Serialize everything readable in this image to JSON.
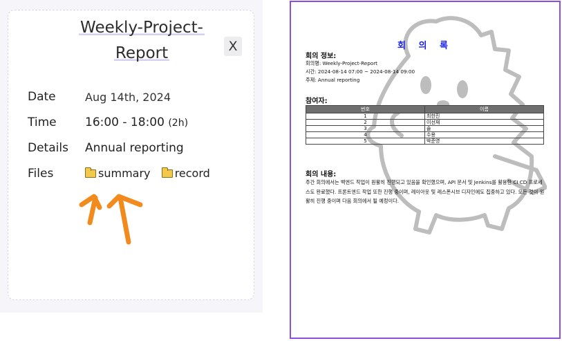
{
  "card": {
    "title_line1": "Weekly-Project-",
    "title_line2": "Report",
    "close_label": "X",
    "date_label": "Date",
    "date_value": "Aug 14th, 2024",
    "time_label": "Time",
    "time_value": "16:00 - 18:00",
    "time_duration": "(2h)",
    "details_label": "Details",
    "details_value": "Annual reporting",
    "files_label": "Files",
    "files": [
      "summary",
      "record"
    ]
  },
  "doc": {
    "title": "회 의 록",
    "info_heading": "회의 정보:",
    "meeting_name": "회의명: Weekly-Project-Report",
    "meeting_time": "시간: 2024-08-14 07:00 ~ 2024-08-14 09:00",
    "meeting_topic": "주제: Annual reporting",
    "participants_heading": "참여자:",
    "table_headers": [
      "번호",
      "이름"
    ],
    "participants": [
      {
        "num": "1",
        "name": "최한진"
      },
      {
        "num": "2",
        "name": "이선재"
      },
      {
        "num": "3",
        "name": "솔"
      },
      {
        "num": "4",
        "name": "수용"
      },
      {
        "num": "5",
        "name": "박준영"
      }
    ],
    "content_heading": "회의 내용:",
    "content": "주간 회의에서는 백엔드 작업이 원활히 진행되고 있음을 확인했으며, API 문서 및 Jenkins를 활용한 CI CD 프로세스도 완료했다. 프론트엔드 작업 또한 진행 중이며, 레이아웃 및 레스폰시브 디자인에도 집중하고 있다. 모든 것이 원활히 진행 중이며 다음 회의에서 될 예정이다."
  },
  "colors": {
    "accent_purple": "#8a4fe0",
    "doc_title_blue": "#1a22e8",
    "arrow_orange": "#f28b1e",
    "title_highlight": "#d4d0f2"
  },
  "icons": {
    "file_icon": "folder-icon",
    "pointer": "arrow-up-icon",
    "watermark": "dinosaur-mascot-icon"
  }
}
